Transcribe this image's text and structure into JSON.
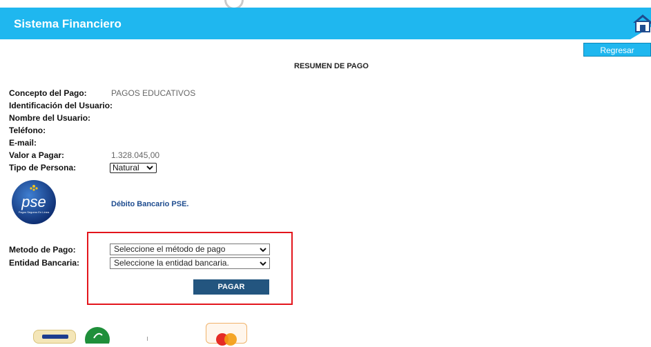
{
  "header": {
    "title": "Sistema Financiero",
    "home_icon": "home-icon"
  },
  "actions": {
    "back_label": "Regresar",
    "pay_label": "PAGAR"
  },
  "summary": {
    "title": "RESUMEN DE PAGO"
  },
  "fields": [
    {
      "label": "Concepto del Pago:",
      "value": "PAGOS EDUCATIVOS"
    },
    {
      "label": "Identificación del Usuario:",
      "value": ""
    },
    {
      "label": "Nombre del Usuario:",
      "value": ""
    },
    {
      "label": "Teléfono:",
      "value": ""
    },
    {
      "label": "E-mail:",
      "value": ""
    },
    {
      "label": "Valor a Pagar:",
      "value": "1.328.045,00"
    },
    {
      "label": "Tipo de Persona:",
      "value": "Natural"
    }
  ],
  "pse": {
    "logo_text": "pse",
    "logo_subtext": "Pagos Seguros En Línea",
    "label": "Débito Bancario PSE."
  },
  "payment": {
    "method_label": "Metodo de Pago:",
    "method_selected": "Seleccione el método de pago",
    "bank_label": "Entidad Bancaria:",
    "bank_selected": "Seleccione la entidad bancaria."
  },
  "colors": {
    "header": "#1fb7ef",
    "pay_button": "#23557f",
    "highlight": "#e3141b",
    "pse_label": "#1e4c8f"
  },
  "footer_logos": [
    "visa-logo",
    "diners-logo",
    "mastercard-logo"
  ]
}
